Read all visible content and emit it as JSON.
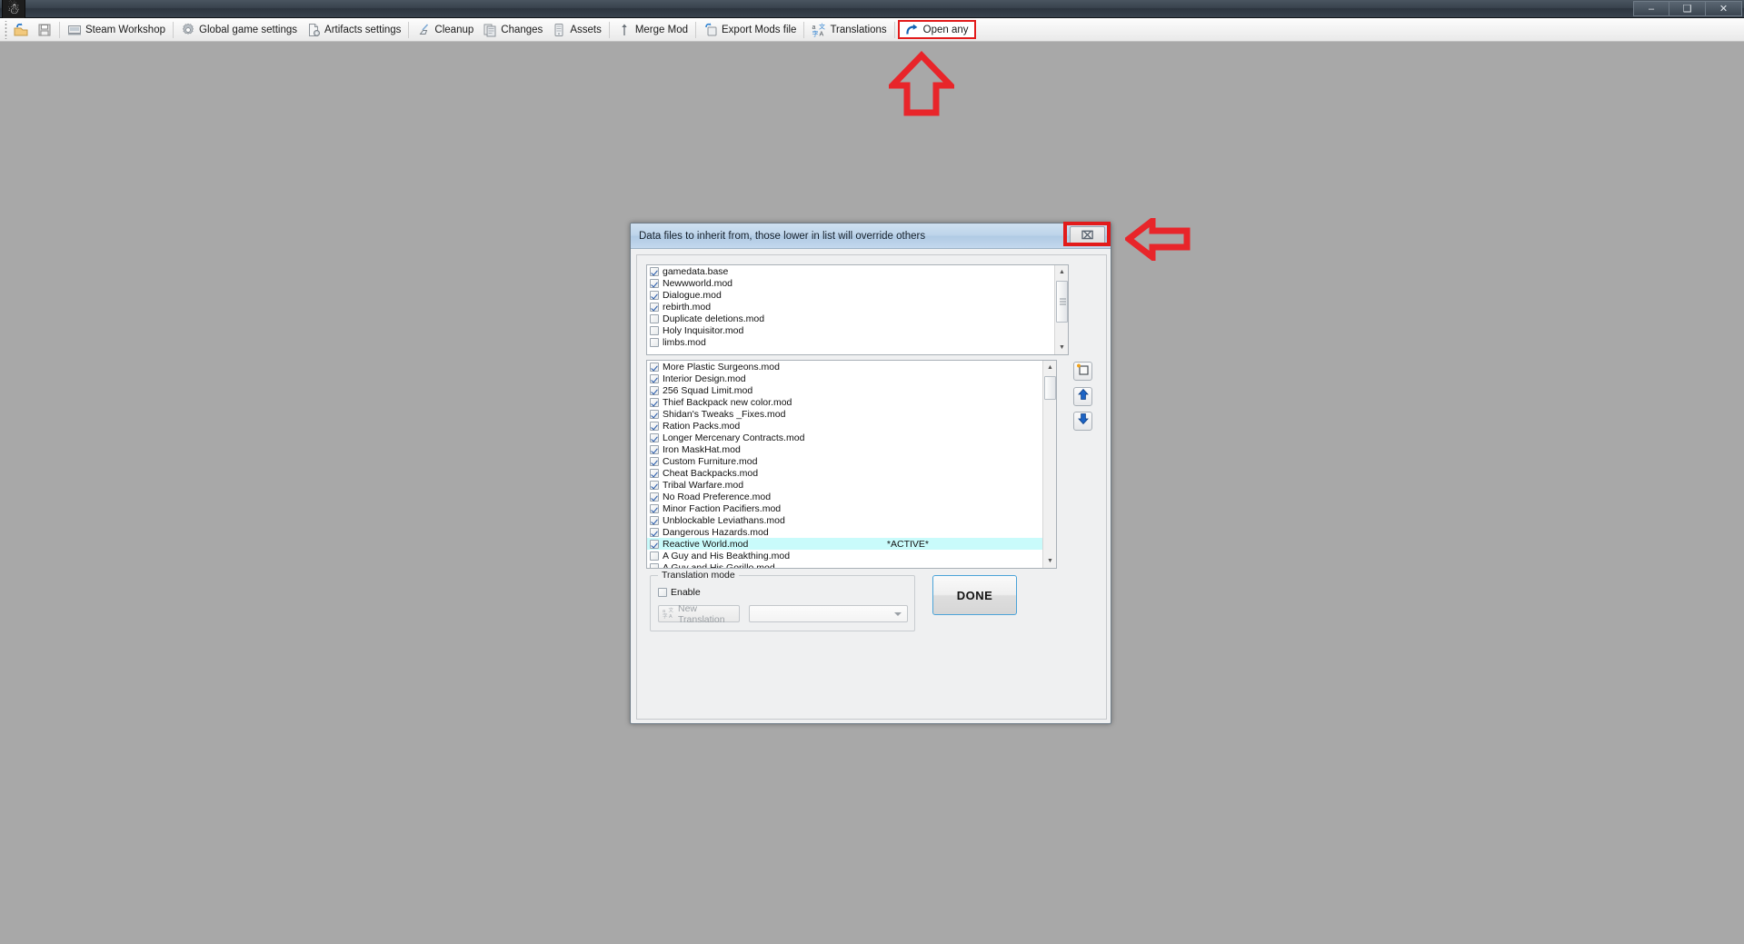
{
  "window": {
    "app_icon": "person-icon",
    "buttons": [
      {
        "name": "minimize-button",
        "glyph": "–"
      },
      {
        "name": "maximize-button",
        "glyph": "❐"
      },
      {
        "name": "close-button",
        "glyph": "✕"
      }
    ]
  },
  "toolbar": {
    "items": [
      {
        "label": "",
        "icon": "open-folder-icon",
        "highlighted": false,
        "sep_after": false
      },
      {
        "label": "",
        "icon": "save-disk-icon",
        "highlighted": false,
        "sep_after": true
      },
      {
        "label": "Steam Workshop",
        "icon": "steam-workshop-icon",
        "highlighted": false,
        "sep_after": true
      },
      {
        "label": "Global game settings",
        "icon": "gear-icon",
        "highlighted": false,
        "sep_after": false
      },
      {
        "label": "Artifacts settings",
        "icon": "artifacts-icon",
        "highlighted": false,
        "sep_after": true
      },
      {
        "label": "Cleanup",
        "icon": "broom-icon",
        "highlighted": false,
        "sep_after": false
      },
      {
        "label": "Changes",
        "icon": "changes-icon",
        "highlighted": false,
        "sep_after": false
      },
      {
        "label": "Assets",
        "icon": "assets-icon",
        "highlighted": false,
        "sep_after": true
      },
      {
        "label": "Merge Mod",
        "icon": "merge-icon",
        "highlighted": false,
        "sep_after": true
      },
      {
        "label": "Export Mods file",
        "icon": "export-icon",
        "highlighted": false,
        "sep_after": true
      },
      {
        "label": "Translations",
        "icon": "translations-icon",
        "highlighted": false,
        "sep_after": true
      },
      {
        "label": "Open any",
        "icon": "open-any-arrow-icon",
        "highlighted": true,
        "sep_after": false
      }
    ]
  },
  "annotations": {
    "accent_color": "#e21b1b",
    "arrow_up": "points-to-open-any-button",
    "arrow_left": "points-to-dialog-close-button"
  },
  "dialog": {
    "title": "Data files to inherit from, those lower in list will override others",
    "close_glyph": "⌧",
    "top_list": {
      "name": "base-data-files-list",
      "items": [
        {
          "label": "gamedata.base",
          "checked": true
        },
        {
          "label": "Newwworld.mod",
          "checked": true
        },
        {
          "label": "Dialogue.mod",
          "checked": true
        },
        {
          "label": "rebirth.mod",
          "checked": true
        },
        {
          "label": "Duplicate deletions.mod",
          "checked": false
        },
        {
          "label": "Holy Inquisitor.mod",
          "checked": false
        },
        {
          "label": "limbs.mod",
          "checked": false
        }
      ]
    },
    "bottom_list": {
      "name": "mod-load-order-list",
      "active_tag": "*ACTIVE*",
      "items": [
        {
          "label": "More Plastic Surgeons.mod",
          "checked": true,
          "active": false
        },
        {
          "label": "Interior Design.mod",
          "checked": true,
          "active": false
        },
        {
          "label": "256 Squad Limit.mod",
          "checked": true,
          "active": false
        },
        {
          "label": "Thief Backpack new color.mod",
          "checked": true,
          "active": false
        },
        {
          "label": "Shidan's Tweaks _Fixes.mod",
          "checked": true,
          "active": false
        },
        {
          "label": "Ration Packs.mod",
          "checked": true,
          "active": false
        },
        {
          "label": "Longer Mercenary Contracts.mod",
          "checked": true,
          "active": false
        },
        {
          "label": "Iron MaskHat.mod",
          "checked": true,
          "active": false
        },
        {
          "label": "Custom Furniture.mod",
          "checked": true,
          "active": false
        },
        {
          "label": "Cheat Backpacks.mod",
          "checked": true,
          "active": false
        },
        {
          "label": "Tribal Warfare.mod",
          "checked": true,
          "active": false
        },
        {
          "label": "No Road Preference.mod",
          "checked": true,
          "active": false
        },
        {
          "label": "Minor Faction Pacifiers.mod",
          "checked": true,
          "active": false
        },
        {
          "label": "Unblockable Leviathans.mod",
          "checked": true,
          "active": false
        },
        {
          "label": "Dangerous Hazards.mod",
          "checked": true,
          "active": false
        },
        {
          "label": "Reactive World.mod",
          "checked": true,
          "active": true
        },
        {
          "label": "A Guy and His Beakthing.mod",
          "checked": false,
          "active": false
        },
        {
          "label": "A Guy and His Gorillo.mod",
          "checked": false,
          "active": false
        }
      ]
    },
    "side_buttons": [
      {
        "name": "new-mod-button",
        "icon": "new-document-icon"
      },
      {
        "name": "move-up-button",
        "icon": "arrow-up-icon"
      },
      {
        "name": "move-down-button",
        "icon": "arrow-down-icon"
      }
    ],
    "translation_mode": {
      "group_label": "Translation mode",
      "enable_label": "Enable",
      "enable_checked": false,
      "new_translation_label": "New Translation",
      "new_translation_icon": "translate-icon",
      "combo_value": "",
      "combo_placeholder": ""
    },
    "done_label": "DONE"
  }
}
